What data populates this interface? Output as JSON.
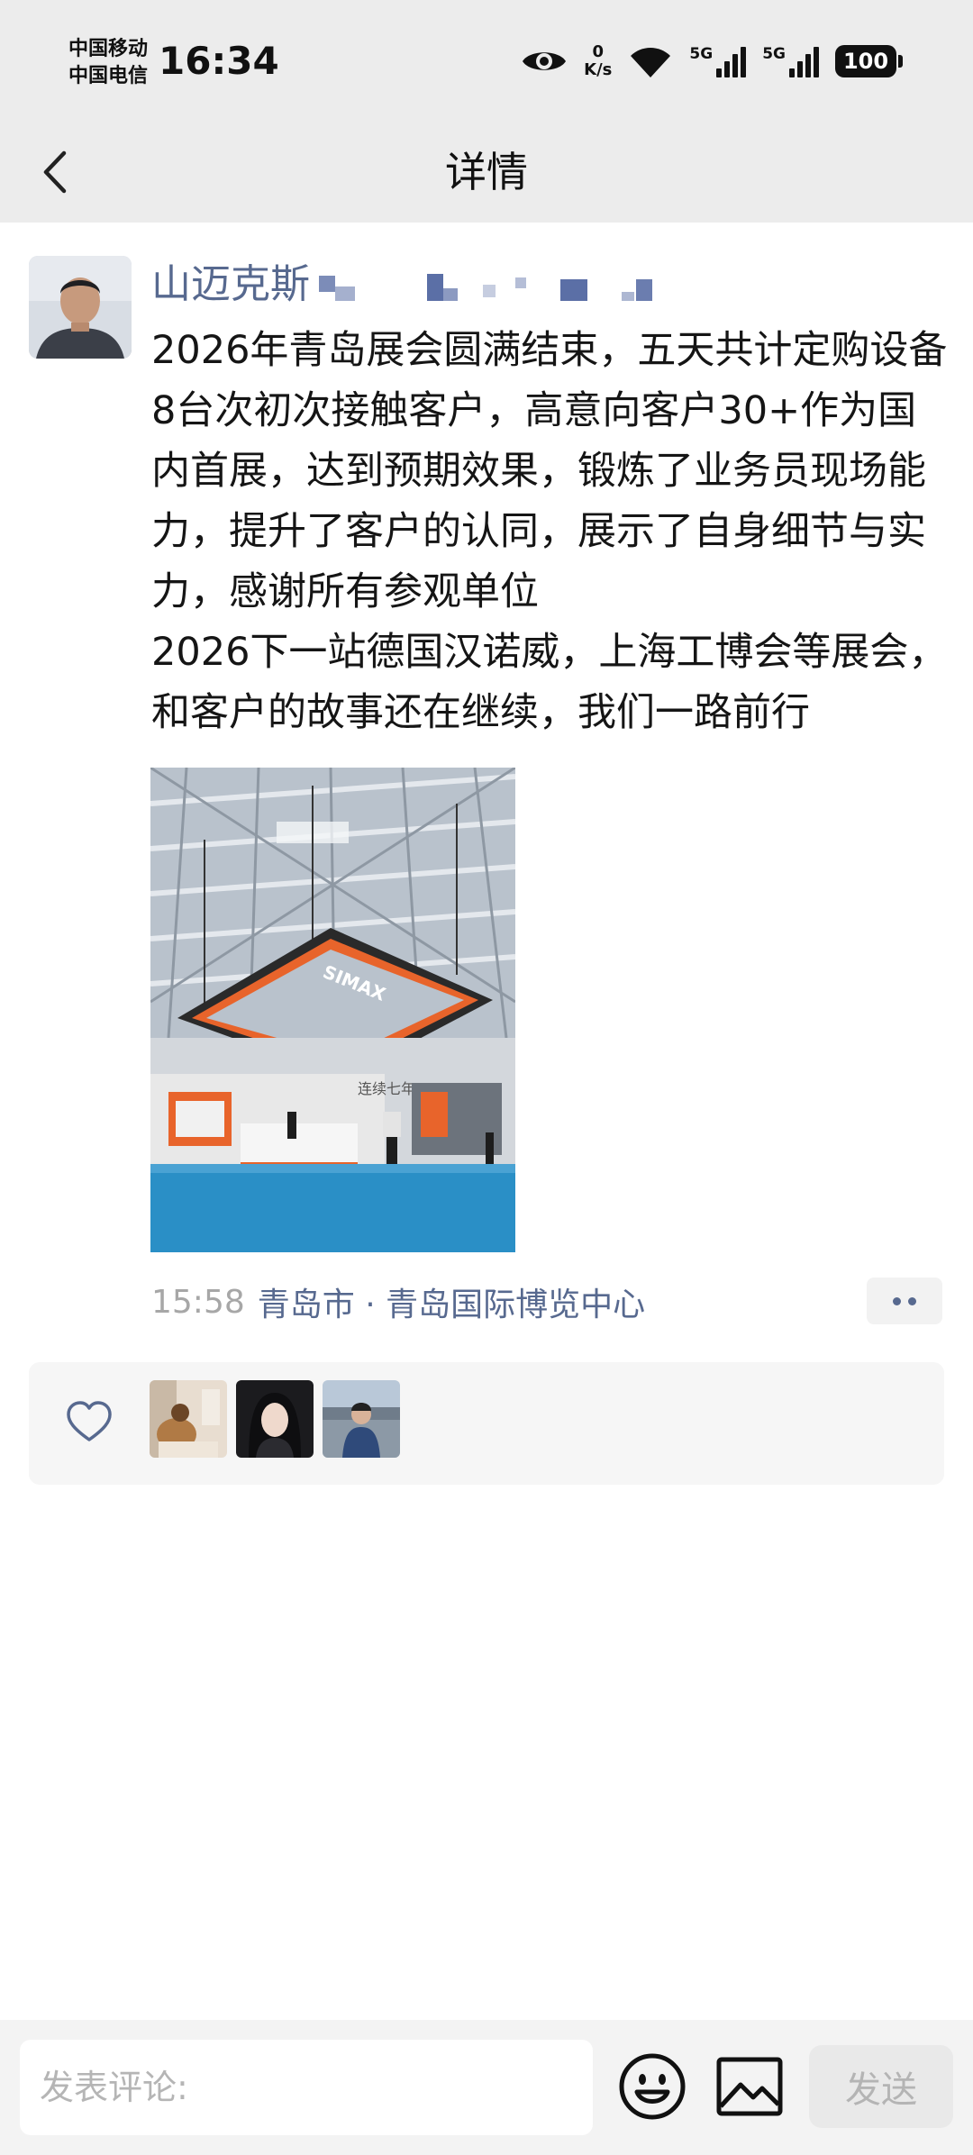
{
  "status_bar": {
    "carrier_1": "中国移动",
    "carrier_2": "中国电信",
    "time": "16:34",
    "net_speed_value": "0",
    "net_speed_unit": "K/s",
    "signal_1_label": "5G",
    "signal_2_label": "5G",
    "battery": "100"
  },
  "header": {
    "title": "详情",
    "back_icon": "chevron-left-icon"
  },
  "post": {
    "author_name": "山迈克斯\u0000",
    "text": "2026年青岛展会圆满结束，五天共计定购设备8台次初次接触客户，高意向客户30+作为国内首展，达到预期效果，锻炼了业务员现场能力，提升了客户的认同，展示了自身细节与实力，感谢所有参观单位\n2026下一站德国汉诺威，上海工博会等展会，和客户的故事还在继续，我们一路前行",
    "photo_sign_text": "SIMAX",
    "photo_banner_text": "连续七年",
    "time": "15:58",
    "location": "青岛市 · 青岛国际博览中心"
  },
  "likes": {
    "icon": "heart-outline-icon",
    "count_avatars": 3
  },
  "comment_bar": {
    "placeholder": "发表评论:",
    "send_label": "发送",
    "emoji_icon": "emoji-icon",
    "image_icon": "image-icon"
  },
  "colors": {
    "bar_background": "#ececec",
    "link_blue": "#57698f",
    "meta_gray": "#a7a7a7",
    "brand_orange": "#e8642b"
  }
}
